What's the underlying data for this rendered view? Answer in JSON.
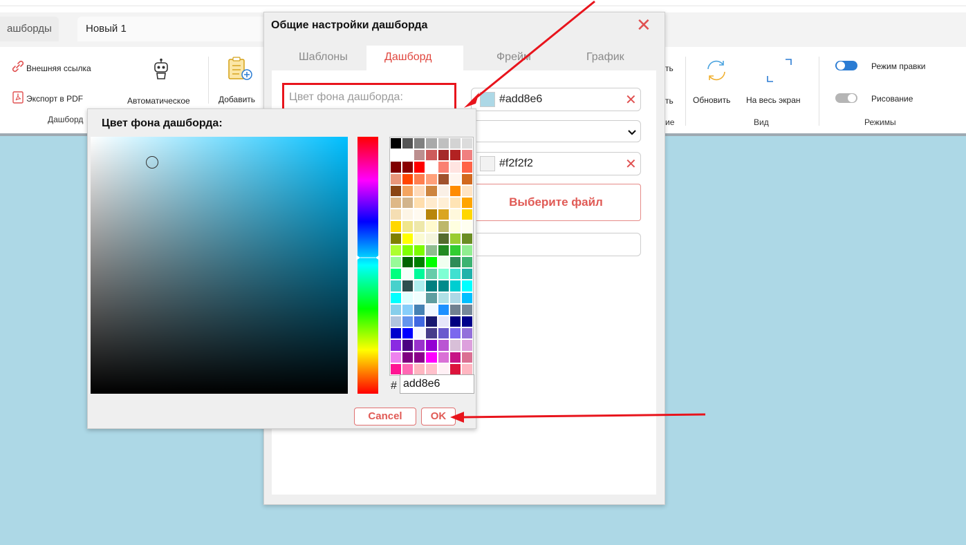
{
  "tabs": {
    "dashboards": "ашборды",
    "new_tab": "Новый 1"
  },
  "ribbon": {
    "external_link": "Внешняя ссылка",
    "export_pdf": "Экспорт в PDF",
    "auto": "Автоматическое",
    "add": "Добавить",
    "group_dash": "Дашборд",
    "right_frag_1": "ть",
    "right_frag_2": "ть",
    "right_frag_3": "ие",
    "refresh": "Обновить",
    "fullscreen": "На весь экран",
    "group_view": "Вид",
    "edit_mode": "Режим правки",
    "drawing": "Рисование",
    "group_modes": "Режимы"
  },
  "dialog": {
    "title": "Общие настройки дашборда",
    "tabs": [
      "Шаблоны",
      "Дашборд",
      "Фрейм",
      "График"
    ],
    "bg_label": "Цвет фона дашборда:",
    "bg_color": "#add8e6",
    "second_color": "#f2f2f2",
    "choose_file": "Выберите файл"
  },
  "picker": {
    "title": "Цвет фона дашборда:",
    "hash": "#",
    "hex": "add8e6",
    "cancel": "Cancel",
    "ok": "OK"
  },
  "colors": {
    "canvas": "#add8e6",
    "accent": "#e05a55",
    "arrow": "#e8141c"
  },
  "palette": [
    "#000000",
    "#555555",
    "#808080",
    "#a9a9a9",
    "#c0c0c0",
    "#d3d3d3",
    "#dcdcdc",
    "#ffffff",
    "#ffffff",
    "#bc8f8f",
    "#cd5c5c",
    "#a52a2a",
    "#b22222",
    "#f08080",
    "#800000",
    "#8b0000",
    "#ff0000",
    "#ffffff",
    "#fa8072",
    "#ffe4e1",
    "#ff6347",
    "#e9967a",
    "#ff4500",
    "#ff7f50",
    "#ffa07a",
    "#a0522d",
    "#fff5ee",
    "#d2691e",
    "#8b4513",
    "#f4a460",
    "#ffdab9",
    "#cd853f",
    "#faf0e6",
    "#ff8c00",
    "#ffe4c4",
    "#deb887",
    "#d2b48c",
    "#ffdead",
    "#ffebcd",
    "#ffefd5",
    "#ffe4b5",
    "#ffa500",
    "#f5deb3",
    "#fdf5e6",
    "#fffaf0",
    "#b8860b",
    "#daa520",
    "#fff8dc",
    "#ffd700",
    "#ffd700",
    "#f0e68c",
    "#eee8aa",
    "#fffacd",
    "#bdb76b",
    "#ffffe0",
    "#fffff0",
    "#808000",
    "#ffff00",
    "#fafad2",
    "#f5f5dc",
    "#556b2f",
    "#9acd32",
    "#6b8e23",
    "#adff2f",
    "#7fff00",
    "#7cfc00",
    "#8fbc8f",
    "#228b22",
    "#32cd32",
    "#90ee90",
    "#98fb98",
    "#006400",
    "#008000",
    "#00ff00",
    "#f0fff0",
    "#2e8b57",
    "#3cb371",
    "#00ff7f",
    "#f5fffa",
    "#00fa9a",
    "#66cdaa",
    "#7fffd4",
    "#40e0d0",
    "#20b2aa",
    "#48d1cc",
    "#2f4f4f",
    "#afeeee",
    "#008080",
    "#008b8b",
    "#00ced1",
    "#00ffff",
    "#00ffff",
    "#e0ffff",
    "#f0ffff",
    "#5f9ea0",
    "#b0e0e6",
    "#add8e6",
    "#00bfff",
    "#87ceeb",
    "#87cefa",
    "#4682b4",
    "#f0f8ff",
    "#1e90ff",
    "#708090",
    "#778899",
    "#b0c4de",
    "#6495ed",
    "#4169e1",
    "#191970",
    "#e6e6fa",
    "#000080",
    "#00008b",
    "#0000cd",
    "#0000ff",
    "#f8f8ff",
    "#483d8b",
    "#6a5acd",
    "#7b68ee",
    "#9370db",
    "#8a2be2",
    "#4b0082",
    "#9932cc",
    "#9400d3",
    "#ba55d3",
    "#d8bfd8",
    "#dda0dd",
    "#ee82ee",
    "#800080",
    "#8b008b",
    "#ff00ff",
    "#da70d6",
    "#c71585",
    "#db7093",
    "#ff1493",
    "#ff69b4",
    "#ffb6c1",
    "#ffc0cb",
    "#fff0f5",
    "#dc143c",
    "#ffb6c1"
  ]
}
